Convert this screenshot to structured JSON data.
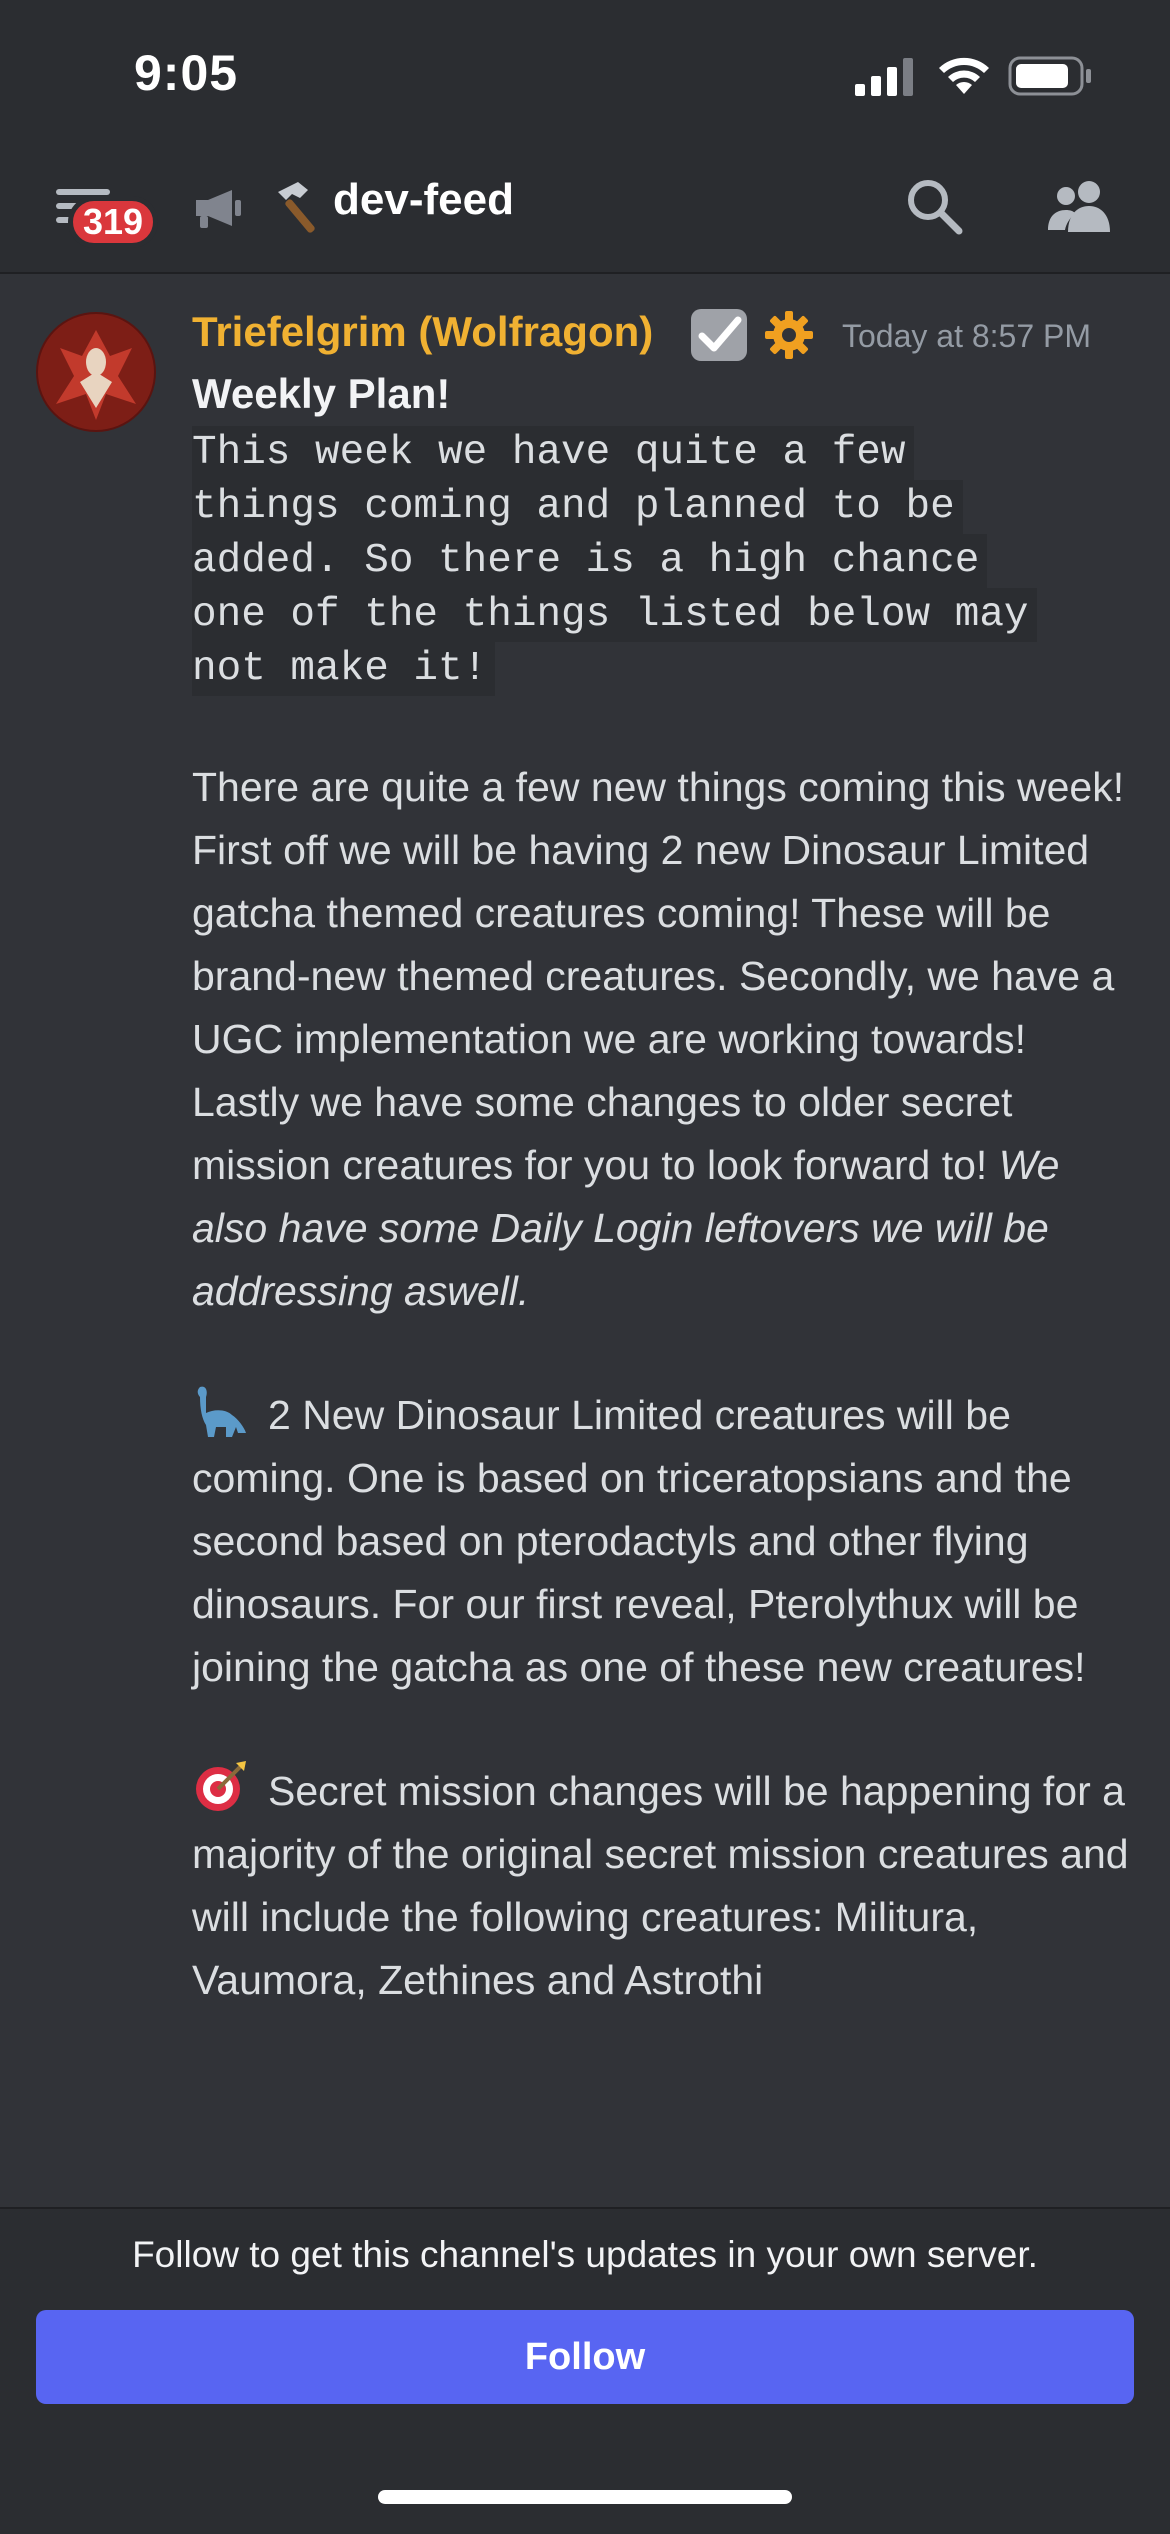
{
  "status_bar": {
    "time": "9:05"
  },
  "header": {
    "unread_count": "319",
    "channel_name": "dev-feed"
  },
  "message": {
    "author": "Triefelgrim (Wolfragon)",
    "timestamp": "Today at 8:57 PM",
    "title": "Weekly Plan!",
    "code_lines": [
      "This week we have quite a few",
      "things coming and planned to be",
      "added. So there is a high chance",
      "one of the things listed below may",
      "not make it!"
    ],
    "intro": "There are quite a few new things coming this week! First off we will be having 2 new Dinosaur Limited gatcha themed creatures coming! These will be brand-new themed creatures. Secondly, we have a UGC implementation we are working towards! Lastly we have some changes to older secret mission creatures for you to look forward to!",
    "intro_italic": "We also have some Daily Login leftovers we will be addressing aswell.",
    "dino_text": "2 New Dinosaur Limited creatures will be coming. One is based on triceratopsians and the second based on pterodactyls and other flying dinosaurs. For our first reveal, Pterolythux will be joining the gatcha as one of these new creatures!",
    "secret_text": "Secret mission changes will be happening for a majority of the original secret mission creatures and will include the following creatures: Militura, Vaumora, Zethines and Astrothi"
  },
  "footer": {
    "follow_prompt": "Follow to get this channel's updates in your own server.",
    "follow_label": "Follow"
  },
  "colors": {
    "accent": "#5865f2",
    "author": "#f0b132",
    "badge": "#da373c",
    "background": "#313338"
  }
}
